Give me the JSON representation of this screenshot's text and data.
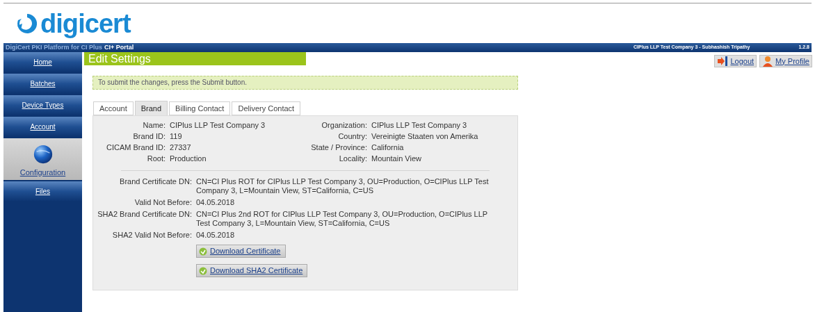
{
  "logo": {
    "text": "digicert"
  },
  "header": {
    "platform": "DigiCert PKI Platform for CI Plus",
    "portal": "CI+ Portal",
    "user": "CIPlus LLP Test Company 3 - Subhashish Tripathy",
    "version": "1.2.8"
  },
  "sidebar": {
    "items": [
      {
        "label": "Home",
        "selected": false
      },
      {
        "label": "Batches",
        "selected": false
      },
      {
        "label": "Device Types",
        "selected": false
      },
      {
        "label": "Account",
        "selected": false
      },
      {
        "label": "Configuration",
        "selected": true
      },
      {
        "label": "Files",
        "selected": false
      }
    ]
  },
  "page_title": "Edit Settings",
  "top_links": [
    {
      "label": "Logout",
      "kind": "logout"
    },
    {
      "label": "My Profile",
      "kind": "profile"
    }
  ],
  "notice": "To submit the changes, press the Submit button.",
  "tabs": [
    {
      "label": "Account",
      "selected": false
    },
    {
      "label": "Brand",
      "selected": true
    },
    {
      "label": "Billing Contact",
      "selected": false
    },
    {
      "label": "Delivery Contact",
      "selected": false
    }
  ],
  "brand": {
    "left": [
      {
        "label": "Name:",
        "value": "CIPlus LLP Test Company 3"
      },
      {
        "label": "Brand ID:",
        "value": "119"
      },
      {
        "label": "CICAM Brand ID:",
        "value": "27337"
      },
      {
        "label": "Root:",
        "value": "Production"
      }
    ],
    "right": [
      {
        "label": "Organization:",
        "value": "CIPlus LLP Test Company 3"
      },
      {
        "label": "Country:",
        "value": "Vereinigte Staaten von Amerika"
      },
      {
        "label": "State / Province:",
        "value": "California"
      },
      {
        "label": "Locality:",
        "value": "Mountain View"
      }
    ],
    "certificates": [
      {
        "label": "Brand Certificate DN:",
        "value": "CN=CI Plus ROT for CIPlus LLP Test Company 3, OU=Production, O=CIPlus LLP Test Company 3, L=Mountain View, ST=California, C=US"
      },
      {
        "label": "Valid Not Before:",
        "value": "04.05.2018"
      },
      {
        "label": "SHA2 Brand Certificate DN:",
        "value": "CN=CI Plus 2nd ROT for CIPlus LLP Test Company 3, OU=Production, O=CIPlus LLP Test Company 3, L=Mountain View, ST=California, C=US"
      },
      {
        "label": "SHA2 Valid Not Before:",
        "value": "04.05.2018"
      }
    ],
    "buttons": [
      "Download Certificate",
      "Download SHA2 Certificate"
    ]
  }
}
